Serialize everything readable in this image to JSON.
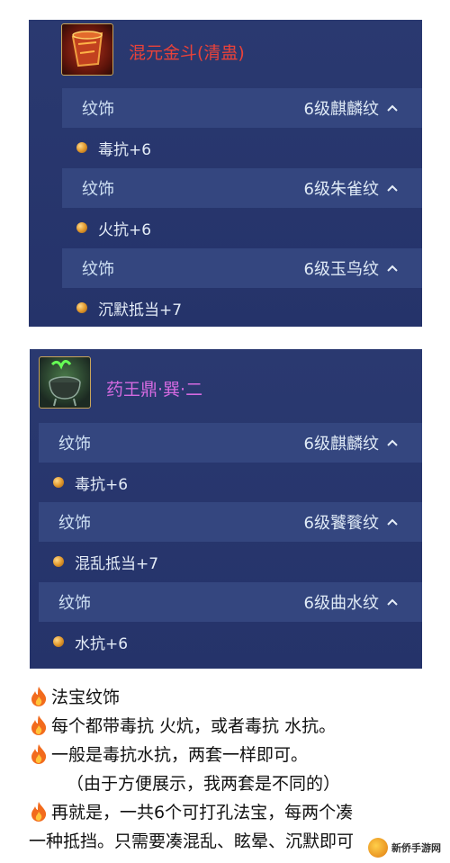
{
  "panel1": {
    "name": "混元金斗(清蛊)",
    "name_color": "#e8423a",
    "rows": [
      {
        "label": "纹饰",
        "value": "6级麒麟纹",
        "effect": "毒抗+6"
      },
      {
        "label": "纹饰",
        "value": "6级朱雀纹",
        "effect": "火抗+6"
      },
      {
        "label": "纹饰",
        "value": "6级玉鸟纹",
        "effect": "沉默抵当+7"
      }
    ]
  },
  "panel2": {
    "name": "药王鼎·巽·二",
    "name_color": "#d46ae0",
    "rows": [
      {
        "label": "纹饰",
        "value": "6级麒麟纹",
        "effect": "毒抗+6"
      },
      {
        "label": "纹饰",
        "value": "6级饕餮纹",
        "effect": "混乱抵当+7"
      },
      {
        "label": "纹饰",
        "value": "6级曲水纹",
        "effect": "水抗+6"
      }
    ]
  },
  "notes": {
    "line1": "法宝纹饰",
    "line2": "每个都带毒抗 火炕，或者毒抗 水抗。",
    "line3": "一般是毒抗水抗，两套一样即可。",
    "line4": "（由于方便展示，我两套是不同的）",
    "line5": "再就是，一共6个可打孔法宝，每两个凑",
    "line6": "一种抵挡。只需要凑混乱、眩晕、沉默即可"
  },
  "watermark": {
    "text": "新侨手游网"
  }
}
